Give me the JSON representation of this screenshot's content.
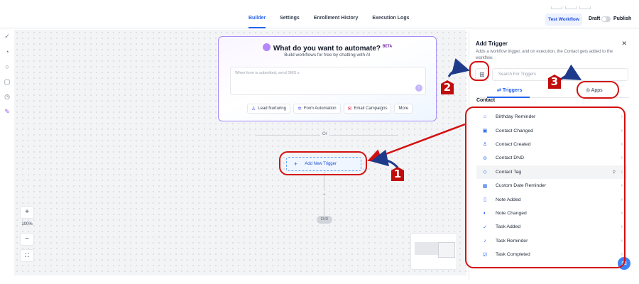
{
  "header": {
    "tabs": [
      {
        "label": "Builder",
        "active": true
      },
      {
        "label": "Settings",
        "active": false
      },
      {
        "label": "Enrollment History",
        "active": false
      },
      {
        "label": "Execution Logs",
        "active": false
      }
    ],
    "test_workflow_label": "Test Workflow",
    "draft_label": "Draft",
    "publish_label": "Publish",
    "publish_toggle_on": false
  },
  "left_rail": {
    "icons": [
      "check-circle-icon",
      "pie-chart-icon",
      "chat-icon",
      "message-icon",
      "clock-icon",
      "magic-wand-icon"
    ]
  },
  "ai_panel": {
    "title": "What do you want to automate?",
    "beta_badge": "BETA",
    "subtitle": "Build workflows for free by chatting with AI",
    "input_placeholder": "When form is submitted, send SMS s",
    "chips": [
      {
        "label": "Lead Nurturing",
        "icon": "person-icon"
      },
      {
        "label": "Form Automation",
        "icon": "gear-icon"
      },
      {
        "label": "Email Campaigns",
        "icon": "mail-icon"
      },
      {
        "label": "More",
        "icon": ""
      }
    ]
  },
  "canvas": {
    "or_label": "Or",
    "add_trigger_label": "Add New Trigger",
    "end_label": "END",
    "zoom_level": "100%"
  },
  "trigger_panel": {
    "title": "Add Trigger",
    "description": "Adds a workflow trigger, and on execution, the Contact gets added to the workflow.",
    "search_placeholder": "Search For Triggers",
    "tabs": [
      {
        "label": "Triggers",
        "active": true
      },
      {
        "label": "Apps",
        "active": false
      }
    ],
    "section_title": "Contact",
    "items": [
      {
        "label": "Birthday Reminder",
        "icon": "cake-icon"
      },
      {
        "label": "Contact Changed",
        "icon": "contact-card-icon"
      },
      {
        "label": "Contact Created",
        "icon": "person-add-icon"
      },
      {
        "label": "Contact DND",
        "icon": "dnd-icon"
      },
      {
        "label": "Contact Tag",
        "icon": "tag-icon",
        "highlighted": true
      },
      {
        "label": "Custom Date Reminder",
        "icon": "calendar-icon"
      },
      {
        "label": "Note Added",
        "icon": "note-icon"
      },
      {
        "label": "Note Changed",
        "icon": "note-edit-icon"
      },
      {
        "label": "Task Added",
        "icon": "check-icon"
      },
      {
        "label": "Task Reminder",
        "icon": "bell-icon"
      },
      {
        "label": "Task Completed",
        "icon": "checkbox-icon"
      }
    ]
  },
  "annotations": {
    "badges": [
      "1",
      "2",
      "3"
    ],
    "color": "#d31010"
  }
}
